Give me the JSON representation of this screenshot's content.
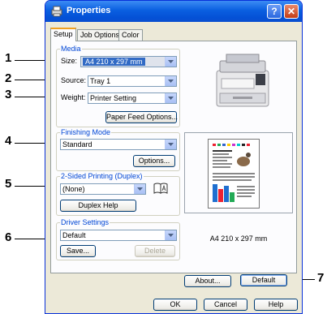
{
  "window": {
    "title": "Properties",
    "help_label": "?",
    "close_label": "✕"
  },
  "tabs": [
    {
      "label": "Setup"
    },
    {
      "label": "Job Options"
    },
    {
      "label": "Color"
    }
  ],
  "callouts": [
    "1",
    "2",
    "3",
    "4",
    "5",
    "6",
    "7"
  ],
  "media": {
    "group_label": "Media",
    "size_label": "Size:",
    "size_value": "A4 210 x 297 mm",
    "source_label": "Source:",
    "source_value": "Tray 1",
    "weight_label": "Weight:",
    "weight_value": "Printer Setting",
    "paper_feed_button": "Paper Feed Options..."
  },
  "finishing": {
    "group_label": "Finishing Mode",
    "value": "Standard",
    "options_button": "Options..."
  },
  "duplex": {
    "group_label": "2-Sided Printing (Duplex)",
    "value": "(None)",
    "help_button": "Duplex Help"
  },
  "driver": {
    "group_label": "Driver Settings",
    "value": "Default",
    "save_button": "Save...",
    "delete_button": "Delete"
  },
  "preview": {
    "caption": "A4 210 x 297 mm"
  },
  "buttons": {
    "about": "About...",
    "default": "Default",
    "ok": "OK",
    "cancel": "Cancel",
    "help": "Help"
  },
  "colors": {
    "title_bar": "#0a5fe0",
    "group_label": "#0046d5",
    "selection": "#316ac5"
  }
}
